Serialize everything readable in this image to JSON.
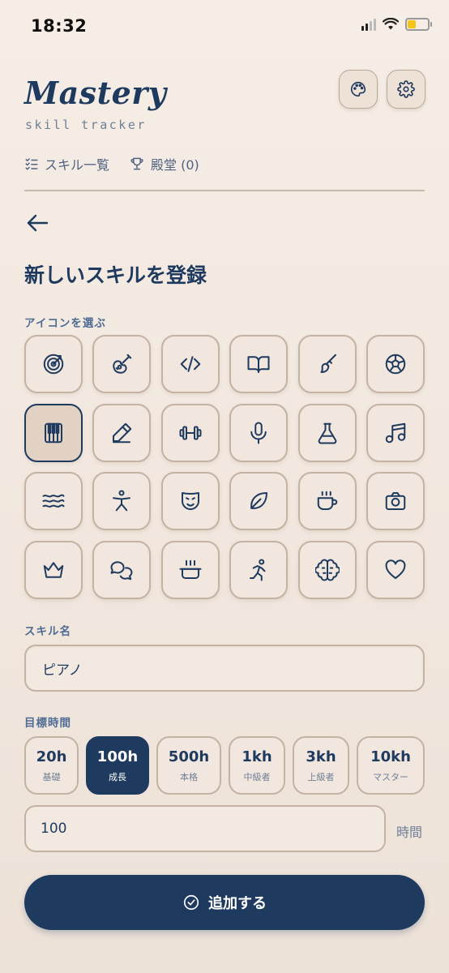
{
  "status": {
    "time": "18:32"
  },
  "header": {
    "logo": "Mastery",
    "subtitle": "skill tracker"
  },
  "nav": {
    "skills_label": "スキル一覧",
    "hall_label": "殿堂 (0)"
  },
  "page": {
    "title": "新しいスキルを登録"
  },
  "icon_section": {
    "label": "アイコンを選ぶ",
    "icons": [
      "target",
      "guitar",
      "code",
      "book",
      "brush",
      "soccer-ball",
      "piano",
      "pencil",
      "dumbbell",
      "microphone",
      "flask",
      "music-note",
      "waves",
      "person",
      "mask",
      "leaf",
      "coffee",
      "camera",
      "crown",
      "chat",
      "pot",
      "runner",
      "brain",
      "heart"
    ],
    "selected": "piano"
  },
  "skill_name": {
    "label": "スキル名",
    "value": "ピアノ"
  },
  "goal": {
    "label": "目標時間",
    "options": [
      {
        "value": "20h",
        "sub": "基礎"
      },
      {
        "value": "100h",
        "sub": "成長"
      },
      {
        "value": "500h",
        "sub": "本格"
      },
      {
        "value": "1kh",
        "sub": "中級者"
      },
      {
        "value": "3kh",
        "sub": "上級者"
      },
      {
        "value": "10kh",
        "sub": "マスター"
      }
    ],
    "selected_index": 1,
    "hours_value": "100",
    "hours_unit": "時間"
  },
  "submit": {
    "label": "追加する"
  },
  "colors": {
    "primary": "#1f3a5f",
    "background": "#f3ebe3",
    "border": "#c4b2a3"
  }
}
